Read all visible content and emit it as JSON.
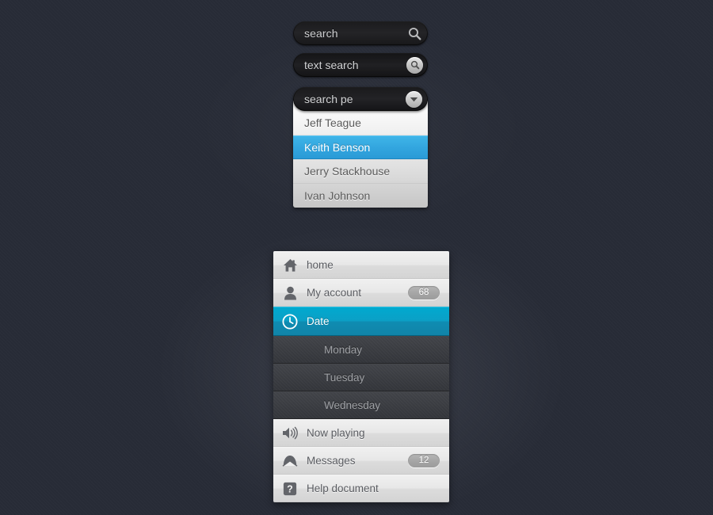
{
  "theme": {
    "background": "#282c37",
    "accent_blue": "#33a6df",
    "accent_teal": "#01a9cf",
    "menu_light": "#e7e7e7",
    "menu_dark": "#3c3e43"
  },
  "search_plain": {
    "value": "search",
    "placeholder": "search",
    "icon": "search-icon"
  },
  "search_button": {
    "value": "text search",
    "placeholder": "text search",
    "icon": "search-icon"
  },
  "dropdown": {
    "value": "search pe",
    "placeholder": "search pe",
    "toggle_icon": "chevron-down-icon",
    "options": [
      {
        "label": "Jeff Teague",
        "selected": false
      },
      {
        "label": "Keith Benson",
        "selected": true
      },
      {
        "label": "Jerry Stackhouse",
        "selected": false
      },
      {
        "label": "Ivan Johnson",
        "selected": false
      }
    ]
  },
  "menu": {
    "items": [
      {
        "label": "home",
        "icon": "home-icon",
        "state": "light",
        "badge": ""
      },
      {
        "label": "My account",
        "icon": "user-icon",
        "state": "light",
        "badge": "68"
      },
      {
        "label": "Date",
        "icon": "clock-icon",
        "state": "active",
        "badge": ""
      },
      {
        "label": "Monday",
        "icon": "",
        "state": "dark",
        "badge": ""
      },
      {
        "label": "Tuesday",
        "icon": "",
        "state": "dark",
        "badge": ""
      },
      {
        "label": "Wednesday",
        "icon": "",
        "state": "dark",
        "badge": ""
      },
      {
        "label": "Now playing",
        "icon": "speaker-icon",
        "state": "light",
        "badge": ""
      },
      {
        "label": "Messages",
        "icon": "envelope-icon",
        "state": "light",
        "badge": "12"
      },
      {
        "label": "Help document",
        "icon": "help-icon",
        "state": "light",
        "badge": ""
      }
    ]
  }
}
